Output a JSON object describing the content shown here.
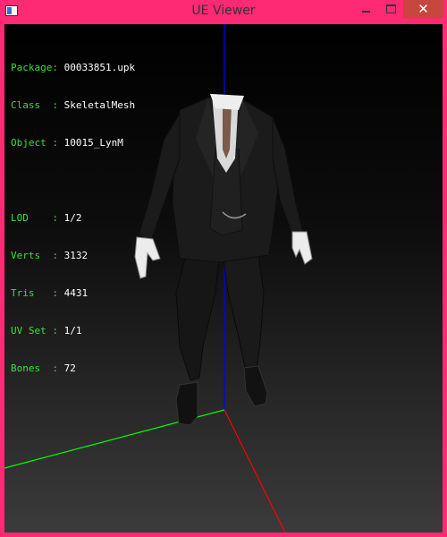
{
  "window": {
    "title": "UE Viewer",
    "controls": {
      "minimize": "—",
      "maximize": "",
      "close": "✕"
    }
  },
  "viewport": {
    "mesh_info": [
      {
        "label": "Package",
        "value": "00033851.upk"
      },
      {
        "label": "Class  ",
        "value": "SkeletalMesh"
      },
      {
        "label": "Object ",
        "value": "10015_LynM"
      }
    ],
    "lod_info": [
      {
        "label": "LOD    ",
        "value": "1/2"
      },
      {
        "label": "Verts  ",
        "value": "3132"
      },
      {
        "label": "Tris   ",
        "value": "4431"
      },
      {
        "label": "UV Set ",
        "value": "1/1"
      },
      {
        "label": "Bones  ",
        "value": "72"
      }
    ]
  },
  "colors": {
    "frame": "#ff2a74",
    "info_label": "#38e038",
    "info_value": "#ffffff",
    "axis_x": "#ff0000",
    "axis_y": "#00ff00",
    "axis_z": "#0000ff"
  }
}
